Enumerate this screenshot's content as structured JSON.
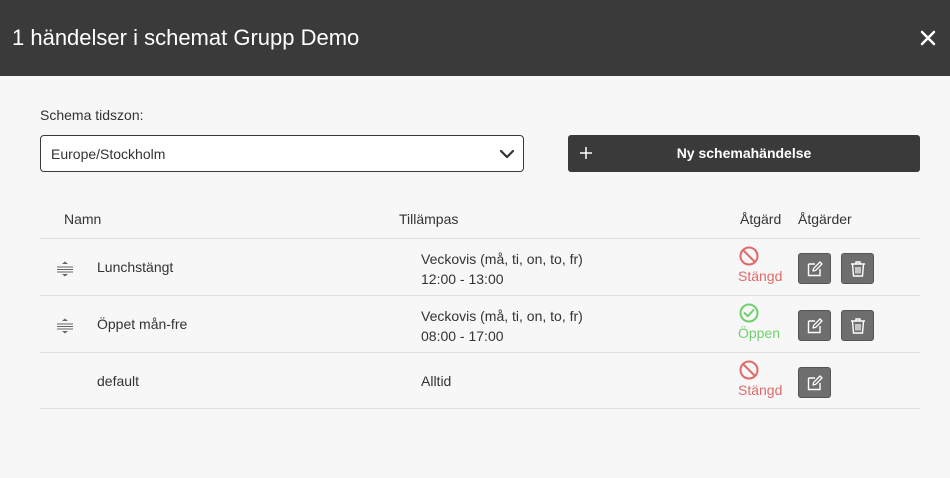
{
  "dialog": {
    "title": "1 händelser i schemat Grupp Demo",
    "close_icon": "close-icon"
  },
  "timezone": {
    "label": "Schema tidszon:",
    "value": "Europe/Stockholm"
  },
  "new_event_button": {
    "label": "Ny schemahändelse",
    "icon": "plus-icon"
  },
  "table": {
    "headers": {
      "name": "Namn",
      "applies": "Tillämpas",
      "action": "Åtgärd",
      "actions": "Åtgärder"
    },
    "rows": [
      {
        "name": "Lunchstängt",
        "applies_line1": "Veckovis (må, ti, on, to, fr)",
        "applies_line2": "12:00 - 13:00",
        "status": "Stängd"
      },
      {
        "name": "Öppet mån-fre",
        "applies_line1": "Veckovis (må, ti, on, to, fr)",
        "applies_line2": "08:00 - 17:00",
        "status": "Öppen"
      },
      {
        "name": "default",
        "applies_line1": "Alltid",
        "status": "Stängd"
      }
    ]
  },
  "colors": {
    "header_bg": "#3a3a3a",
    "closed": "#e06a6a",
    "open": "#6fcf6f",
    "action_button": "#6e6e6e"
  }
}
